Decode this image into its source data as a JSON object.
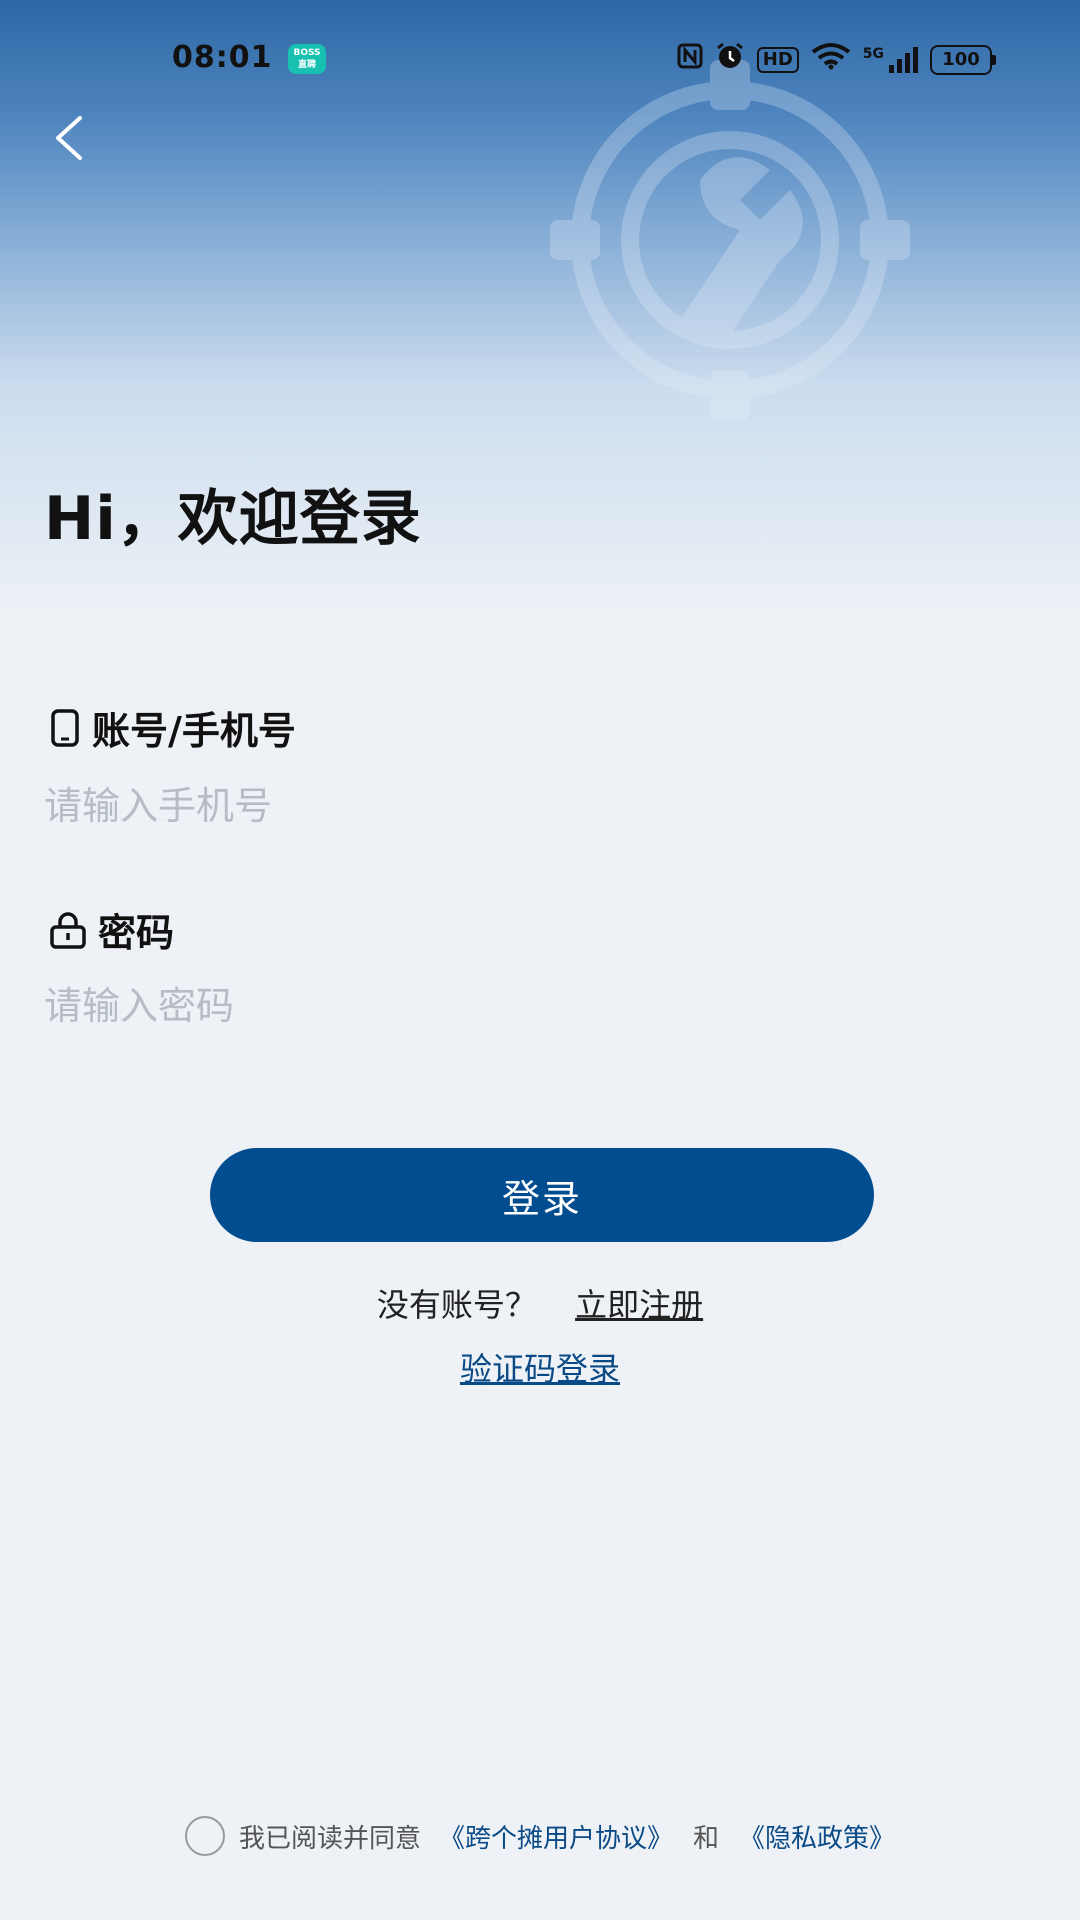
{
  "status_bar": {
    "time": "08:01",
    "boss_badge_line1": "BOSS",
    "boss_badge_line2": "直聘",
    "hd_label": "HD",
    "network_label": "5G",
    "battery": "100"
  },
  "welcome_title": "Hi，欢迎登录",
  "account_field": {
    "label": "账号/手机号",
    "placeholder": "请输入手机号"
  },
  "password_field": {
    "label": "密码",
    "placeholder": "请输入密码"
  },
  "login_button": "登录",
  "register": {
    "prompt": "没有账号？",
    "link": "立即注册"
  },
  "code_login": "验证码登录",
  "agreement": {
    "prefix": "我已阅读并同意",
    "user_agreement": "《跨个摊用户协议》",
    "and": "和",
    "privacy_policy": "《隐私政策》"
  },
  "colors": {
    "primary": "#014d8f",
    "link": "#0a4a86",
    "header_gradient_top": "#2f68a5"
  }
}
